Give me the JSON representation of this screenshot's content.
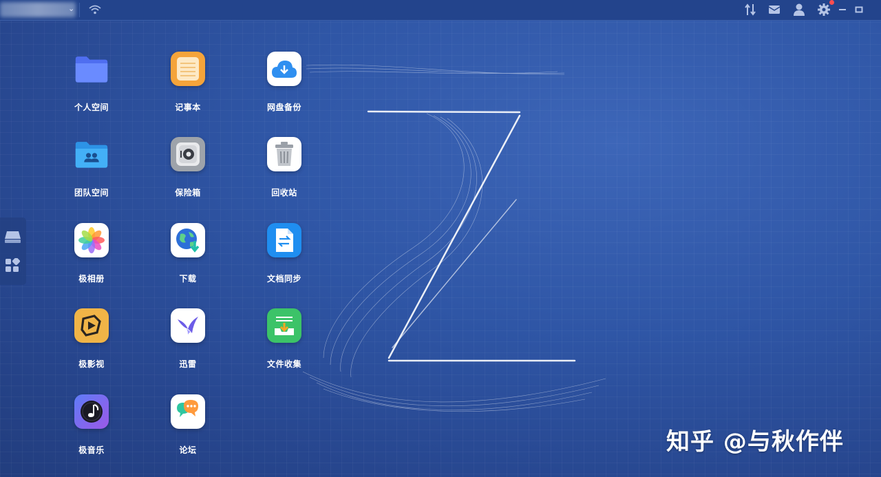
{
  "topbar": {
    "device_caret": "⌄",
    "icons": [
      "wifi-icon",
      "transfer-icon",
      "mail-icon",
      "user-icon",
      "settings-icon",
      "minimize-icon",
      "maximize-icon"
    ]
  },
  "sidebar": {
    "icons": [
      "storage-icon",
      "apps-grid-icon"
    ]
  },
  "apps": [
    {
      "label": "个人空间",
      "icon": "personal-folder-icon"
    },
    {
      "label": "记事本",
      "icon": "notepad-icon"
    },
    {
      "label": "网盘备份",
      "icon": "cloud-backup-icon"
    },
    {
      "label": "团队空间",
      "icon": "team-folder-icon"
    },
    {
      "label": "保险箱",
      "icon": "safe-icon"
    },
    {
      "label": "回收站",
      "icon": "trash-icon"
    },
    {
      "label": "极相册",
      "icon": "photos-icon"
    },
    {
      "label": "下载",
      "icon": "download-globe-icon"
    },
    {
      "label": "文档同步",
      "icon": "doc-sync-icon"
    },
    {
      "label": "极影视",
      "icon": "video-icon"
    },
    {
      "label": "迅雷",
      "icon": "xunlei-icon"
    },
    {
      "label": "文件收集",
      "icon": "file-collect-icon"
    },
    {
      "label": "极音乐",
      "icon": "music-icon"
    },
    {
      "label": "论坛",
      "icon": "forum-icon"
    }
  ],
  "watermark": "知乎 @与秋作伴",
  "colors": {
    "background": "#2f56a6",
    "topbar": "#23448c",
    "badge": "#ff4d4f"
  }
}
